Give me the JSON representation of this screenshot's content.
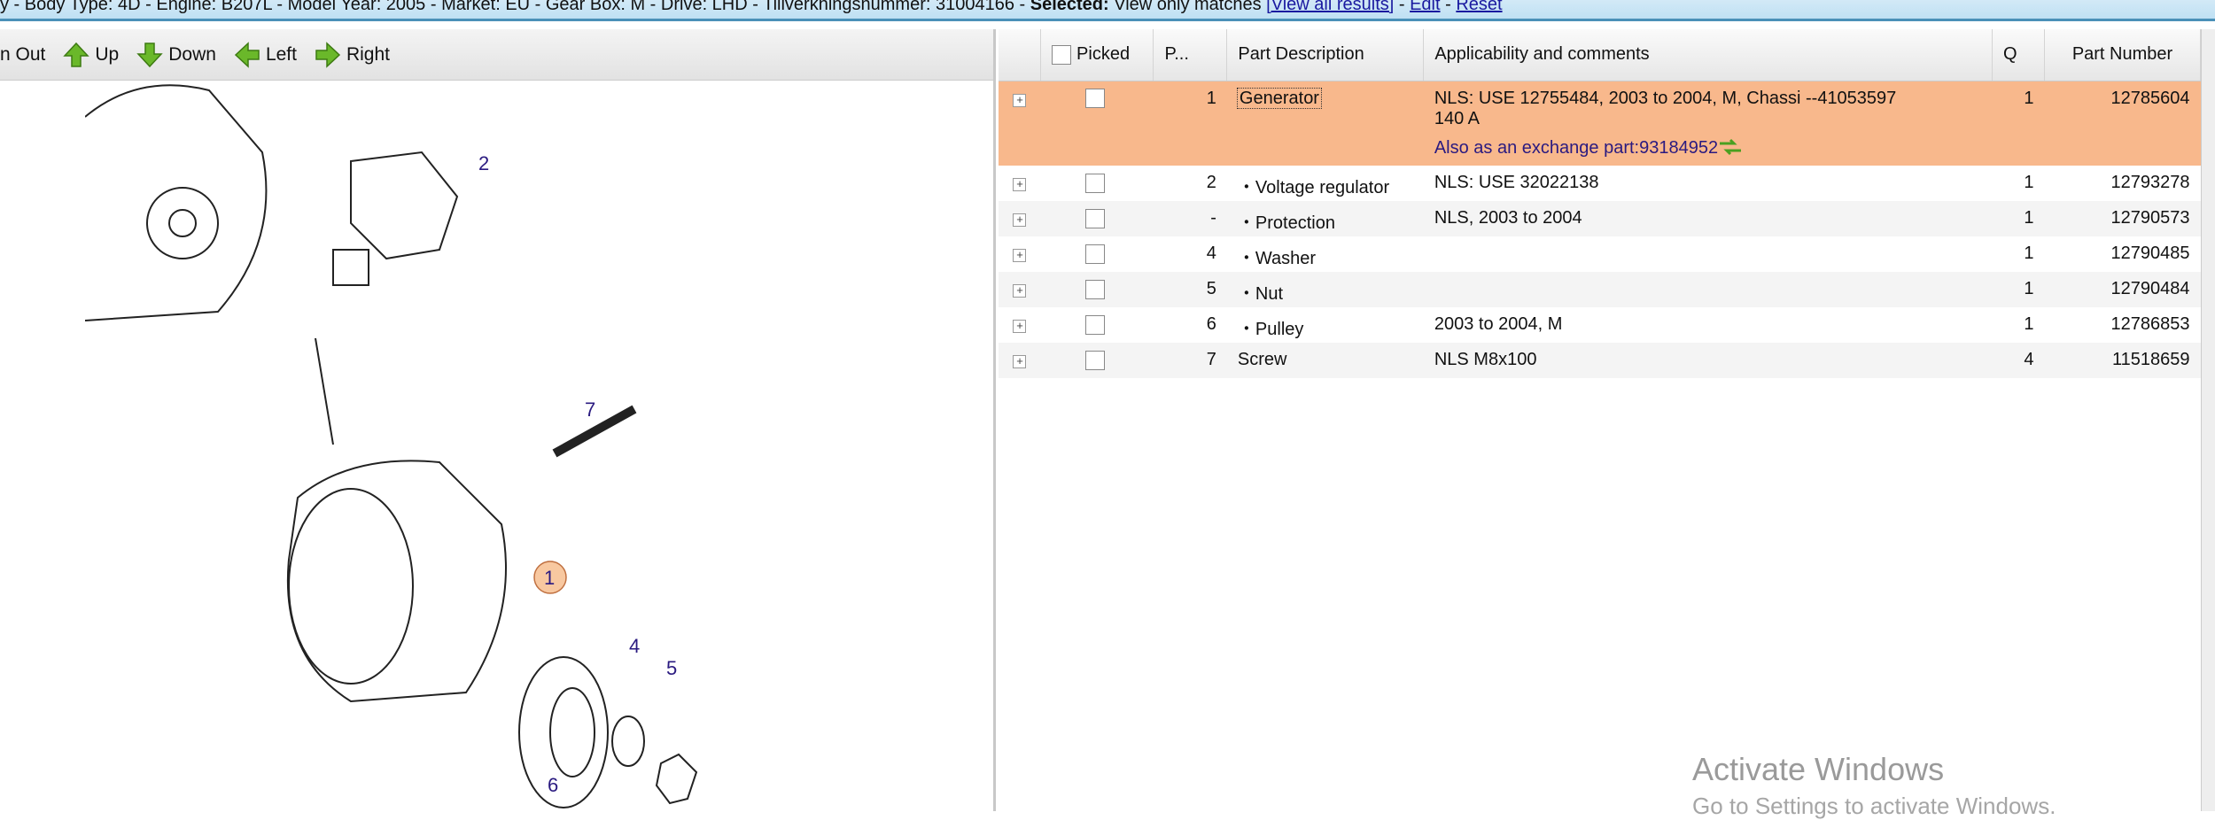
{
  "topbar": {
    "info": "y - Body Type: 4D - Engine: B207L - Model Year: 2005 - Market: EU - Gear Box: M - Drive: LHD - Tillverkningsnummer: 31004166 - ",
    "selected_label": "Selected:",
    "selected_text": " View only matches ",
    "view_all": "[View all results]",
    "sep1": " - ",
    "edit": "Edit",
    "sep2": " - ",
    "reset": "Reset"
  },
  "toolbar": {
    "zoom_out": "n Out",
    "up": "Up",
    "down": "Down",
    "left": "Left",
    "right": "Right",
    "arrow_color": "#6ab82a"
  },
  "diagram": {
    "callouts": [
      "1",
      "2",
      "4",
      "5",
      "6",
      "7"
    ]
  },
  "table": {
    "headers": {
      "picked": "Picked",
      "pos": "P...",
      "desc": "Part Description",
      "appl": "Applicability and comments",
      "q": "Q",
      "part": "Part Number"
    },
    "rows": [
      {
        "pos": "1",
        "desc": "Generator",
        "appl": "NLS: USE 12755484, 2003 to 2004, M, Chassi --41053597",
        "appl2": "140 A",
        "exchange": "Also as an exchange part:93184952",
        "q": "1",
        "part": "12785604"
      },
      {
        "pos": "2",
        "desc": "・Voltage regulator",
        "appl": "NLS: USE 32022138",
        "q": "1",
        "part": "12793278"
      },
      {
        "pos": "-",
        "desc": "・Protection",
        "appl": "NLS, 2003 to 2004",
        "q": "1",
        "part": "12790573"
      },
      {
        "pos": "4",
        "desc": "・Washer",
        "appl": "",
        "q": "1",
        "part": "12790485"
      },
      {
        "pos": "5",
        "desc": "・Nut",
        "appl": "",
        "q": "1",
        "part": "12790484"
      },
      {
        "pos": "6",
        "desc": "・Pulley",
        "appl": "2003 to 2004, M",
        "q": "1",
        "part": "12786853"
      },
      {
        "pos": "7",
        "desc": "Screw",
        "appl": "NLS M8x100",
        "q": "4",
        "part": "11518659"
      }
    ],
    "selected_color": "#f8b88c"
  },
  "watermark": {
    "line1": "Activate Windows",
    "line2": "Go to Settings to activate Windows."
  }
}
